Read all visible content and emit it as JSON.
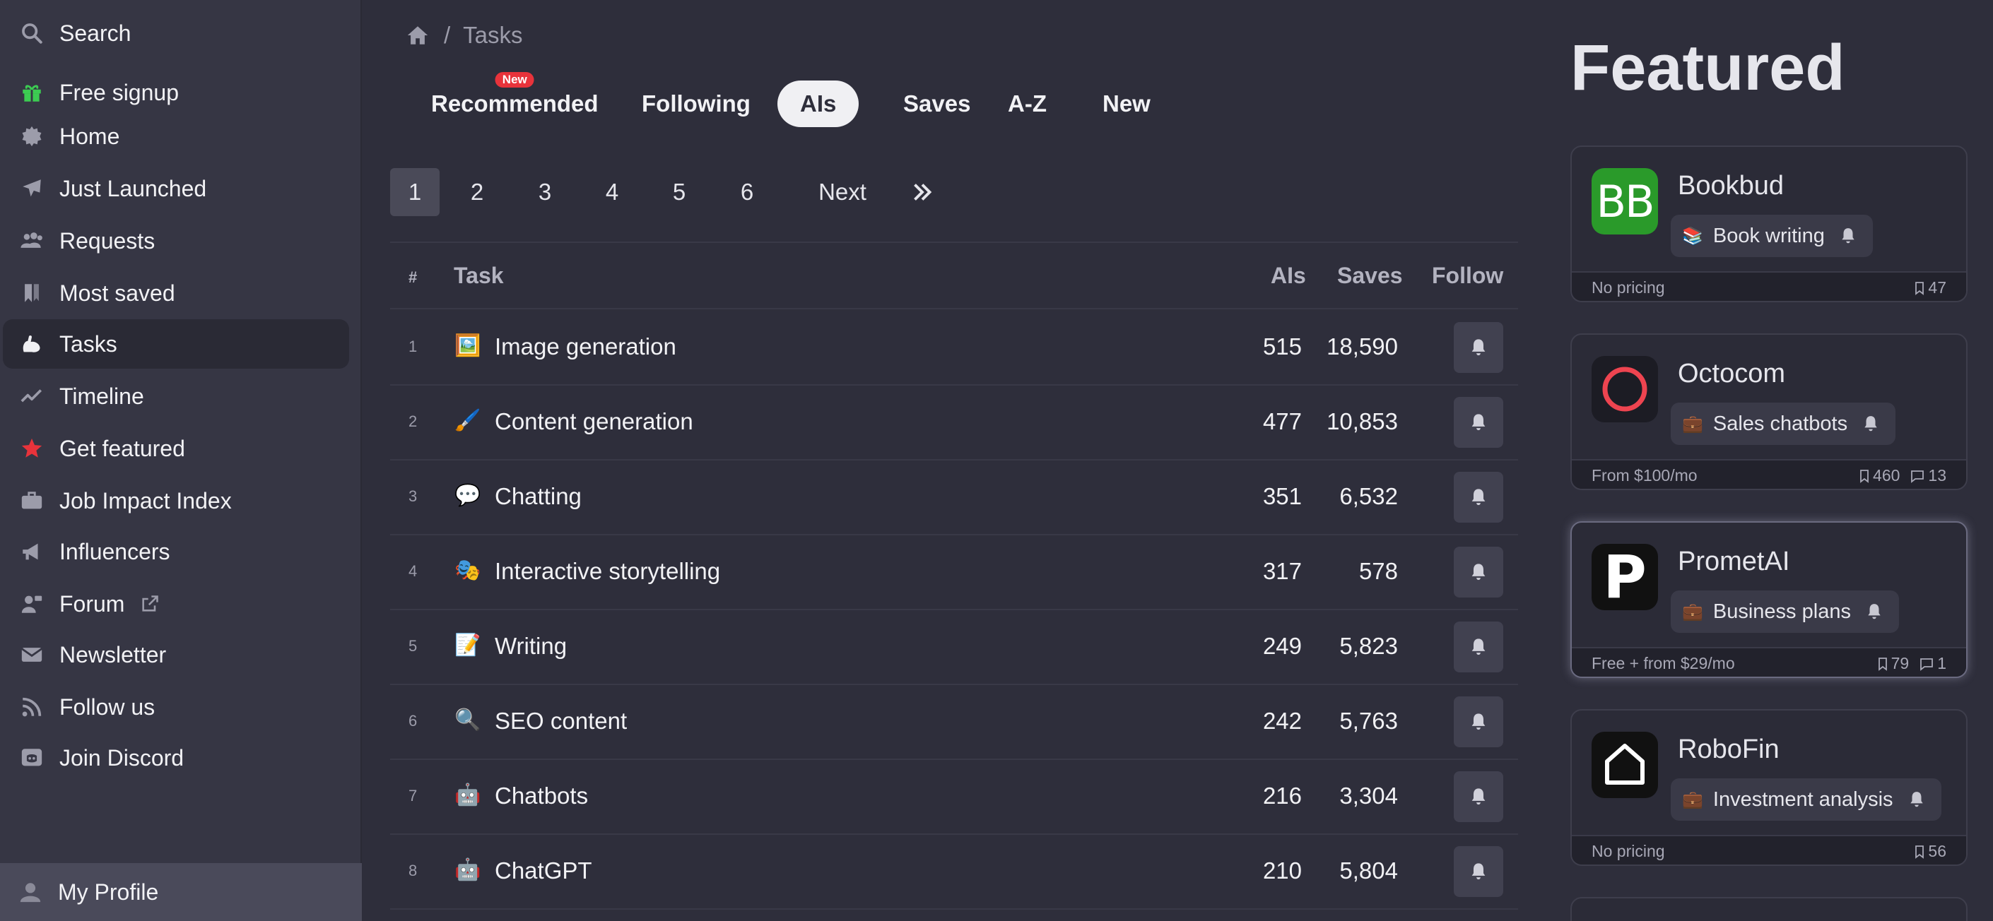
{
  "sidebar": {
    "items": [
      {
        "label": "Search",
        "icon": "search-icon"
      },
      {
        "label": "Free signup",
        "icon": "gift-icon",
        "color": "#3ccc52"
      },
      {
        "label": "Home",
        "icon": "gear-badge-icon"
      },
      {
        "label": "Just Launched",
        "icon": "plane-icon"
      },
      {
        "label": "Requests",
        "icon": "people-icon"
      },
      {
        "label": "Most saved",
        "icon": "bookmarks-icon"
      },
      {
        "label": "Tasks",
        "icon": "flexed-arm-icon",
        "active": true
      },
      {
        "label": "Timeline",
        "icon": "trend-line-icon"
      },
      {
        "label": "Get featured",
        "icon": "star-icon",
        "color": "#e8333b"
      },
      {
        "label": "Job Impact Index",
        "icon": "briefcase-icon"
      },
      {
        "label": "Influencers",
        "icon": "megaphone-icon"
      },
      {
        "label": "Forum",
        "icon": "person-chat-icon"
      },
      {
        "label": "Newsletter",
        "icon": "envelope-icon"
      },
      {
        "label": "Follow us",
        "icon": "rss-icon"
      },
      {
        "label": "Join Discord",
        "icon": "discord-icon"
      }
    ],
    "profile_label": "My Profile"
  },
  "breadcrumb": {
    "separator": "/",
    "current": "Tasks"
  },
  "tabs": [
    {
      "label": "Recommended",
      "badge": "New"
    },
    {
      "label": "Following"
    },
    {
      "label": "AIs",
      "active": true
    },
    {
      "label": "Saves"
    },
    {
      "label": "A-Z"
    },
    {
      "label": "New"
    }
  ],
  "pagination": {
    "pages": [
      "1",
      "2",
      "3",
      "4",
      "5",
      "6"
    ],
    "current": "1",
    "next_label": "Next"
  },
  "table": {
    "headers": {
      "num": "#",
      "task": "Task",
      "ais": "AIs",
      "saves": "Saves",
      "follow": "Follow"
    },
    "rows": [
      {
        "num": "1",
        "emoji": "🖼️",
        "task": "Image generation",
        "ais": "515",
        "saves": "18,590"
      },
      {
        "num": "2",
        "emoji": "🖌️",
        "task": "Content generation",
        "ais": "477",
        "saves": "10,853"
      },
      {
        "num": "3",
        "emoji": "💬",
        "task": "Chatting",
        "ais": "351",
        "saves": "6,532"
      },
      {
        "num": "4",
        "emoji": "🎭",
        "task": "Interactive storytelling",
        "ais": "317",
        "saves": "578"
      },
      {
        "num": "5",
        "emoji": "📝",
        "task": "Writing",
        "ais": "249",
        "saves": "5,823"
      },
      {
        "num": "6",
        "emoji": "🔍",
        "task": "SEO content",
        "ais": "242",
        "saves": "5,763"
      },
      {
        "num": "7",
        "emoji": "🤖",
        "task": "Chatbots",
        "ais": "216",
        "saves": "3,304"
      },
      {
        "num": "8",
        "emoji": "🤖",
        "task": "ChatGPT",
        "ais": "210",
        "saves": "5,804"
      }
    ]
  },
  "featured": {
    "title": "Featured",
    "cards": [
      {
        "name": "Bookbud",
        "logo_text": "BB",
        "logo_color": "#2a9a2a",
        "tag_emoji": "📚",
        "tag": "Book writing",
        "price": "No pricing",
        "saves": "47",
        "comments": ""
      },
      {
        "name": "Octocom",
        "logo_text": "",
        "logo_color": "#1c1c24",
        "tag_emoji": "💼",
        "tag": "Sales chatbots",
        "price": "From $100/mo",
        "saves": "460",
        "comments": "13"
      },
      {
        "name": "PrometAI",
        "logo_text": "P",
        "logo_color": "#111111",
        "tag_emoji": "💼",
        "tag": "Business plans",
        "price": "Free + from $29/mo",
        "saves": "79",
        "comments": "1"
      },
      {
        "name": "RoboFin",
        "logo_text": "",
        "logo_color": "#111111",
        "tag_emoji": "💼",
        "tag": "Investment analysis",
        "price": "No pricing",
        "saves": "56",
        "comments": ""
      }
    ]
  }
}
